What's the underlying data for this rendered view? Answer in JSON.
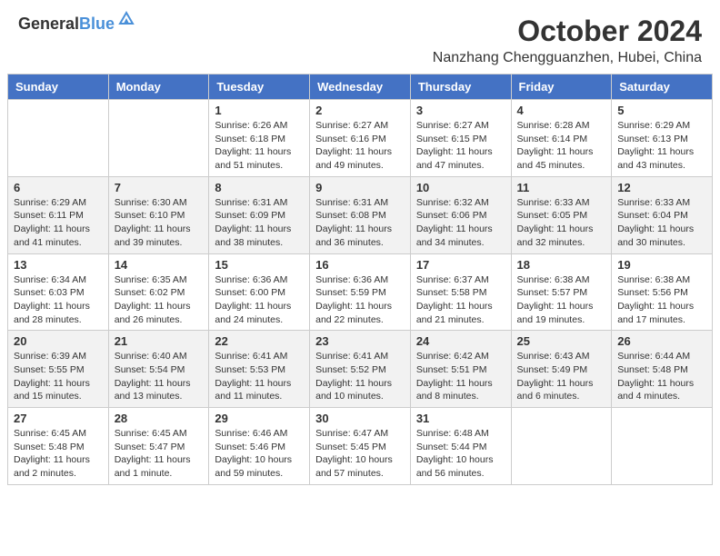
{
  "header": {
    "logo_general": "General",
    "logo_blue": "Blue",
    "month": "October 2024",
    "location": "Nanzhang Chengguanzhen, Hubei, China"
  },
  "days_of_week": [
    "Sunday",
    "Monday",
    "Tuesday",
    "Wednesday",
    "Thursday",
    "Friday",
    "Saturday"
  ],
  "weeks": [
    [
      {
        "day": "",
        "sunrise": "",
        "sunset": "",
        "daylight": ""
      },
      {
        "day": "",
        "sunrise": "",
        "sunset": "",
        "daylight": ""
      },
      {
        "day": "1",
        "sunrise": "Sunrise: 6:26 AM",
        "sunset": "Sunset: 6:18 PM",
        "daylight": "Daylight: 11 hours and 51 minutes."
      },
      {
        "day": "2",
        "sunrise": "Sunrise: 6:27 AM",
        "sunset": "Sunset: 6:16 PM",
        "daylight": "Daylight: 11 hours and 49 minutes."
      },
      {
        "day": "3",
        "sunrise": "Sunrise: 6:27 AM",
        "sunset": "Sunset: 6:15 PM",
        "daylight": "Daylight: 11 hours and 47 minutes."
      },
      {
        "day": "4",
        "sunrise": "Sunrise: 6:28 AM",
        "sunset": "Sunset: 6:14 PM",
        "daylight": "Daylight: 11 hours and 45 minutes."
      },
      {
        "day": "5",
        "sunrise": "Sunrise: 6:29 AM",
        "sunset": "Sunset: 6:13 PM",
        "daylight": "Daylight: 11 hours and 43 minutes."
      }
    ],
    [
      {
        "day": "6",
        "sunrise": "Sunrise: 6:29 AM",
        "sunset": "Sunset: 6:11 PM",
        "daylight": "Daylight: 11 hours and 41 minutes."
      },
      {
        "day": "7",
        "sunrise": "Sunrise: 6:30 AM",
        "sunset": "Sunset: 6:10 PM",
        "daylight": "Daylight: 11 hours and 39 minutes."
      },
      {
        "day": "8",
        "sunrise": "Sunrise: 6:31 AM",
        "sunset": "Sunset: 6:09 PM",
        "daylight": "Daylight: 11 hours and 38 minutes."
      },
      {
        "day": "9",
        "sunrise": "Sunrise: 6:31 AM",
        "sunset": "Sunset: 6:08 PM",
        "daylight": "Daylight: 11 hours and 36 minutes."
      },
      {
        "day": "10",
        "sunrise": "Sunrise: 6:32 AM",
        "sunset": "Sunset: 6:06 PM",
        "daylight": "Daylight: 11 hours and 34 minutes."
      },
      {
        "day": "11",
        "sunrise": "Sunrise: 6:33 AM",
        "sunset": "Sunset: 6:05 PM",
        "daylight": "Daylight: 11 hours and 32 minutes."
      },
      {
        "day": "12",
        "sunrise": "Sunrise: 6:33 AM",
        "sunset": "Sunset: 6:04 PM",
        "daylight": "Daylight: 11 hours and 30 minutes."
      }
    ],
    [
      {
        "day": "13",
        "sunrise": "Sunrise: 6:34 AM",
        "sunset": "Sunset: 6:03 PM",
        "daylight": "Daylight: 11 hours and 28 minutes."
      },
      {
        "day": "14",
        "sunrise": "Sunrise: 6:35 AM",
        "sunset": "Sunset: 6:02 PM",
        "daylight": "Daylight: 11 hours and 26 minutes."
      },
      {
        "day": "15",
        "sunrise": "Sunrise: 6:36 AM",
        "sunset": "Sunset: 6:00 PM",
        "daylight": "Daylight: 11 hours and 24 minutes."
      },
      {
        "day": "16",
        "sunrise": "Sunrise: 6:36 AM",
        "sunset": "Sunset: 5:59 PM",
        "daylight": "Daylight: 11 hours and 22 minutes."
      },
      {
        "day": "17",
        "sunrise": "Sunrise: 6:37 AM",
        "sunset": "Sunset: 5:58 PM",
        "daylight": "Daylight: 11 hours and 21 minutes."
      },
      {
        "day": "18",
        "sunrise": "Sunrise: 6:38 AM",
        "sunset": "Sunset: 5:57 PM",
        "daylight": "Daylight: 11 hours and 19 minutes."
      },
      {
        "day": "19",
        "sunrise": "Sunrise: 6:38 AM",
        "sunset": "Sunset: 5:56 PM",
        "daylight": "Daylight: 11 hours and 17 minutes."
      }
    ],
    [
      {
        "day": "20",
        "sunrise": "Sunrise: 6:39 AM",
        "sunset": "Sunset: 5:55 PM",
        "daylight": "Daylight: 11 hours and 15 minutes."
      },
      {
        "day": "21",
        "sunrise": "Sunrise: 6:40 AM",
        "sunset": "Sunset: 5:54 PM",
        "daylight": "Daylight: 11 hours and 13 minutes."
      },
      {
        "day": "22",
        "sunrise": "Sunrise: 6:41 AM",
        "sunset": "Sunset: 5:53 PM",
        "daylight": "Daylight: 11 hours and 11 minutes."
      },
      {
        "day": "23",
        "sunrise": "Sunrise: 6:41 AM",
        "sunset": "Sunset: 5:52 PM",
        "daylight": "Daylight: 11 hours and 10 minutes."
      },
      {
        "day": "24",
        "sunrise": "Sunrise: 6:42 AM",
        "sunset": "Sunset: 5:51 PM",
        "daylight": "Daylight: 11 hours and 8 minutes."
      },
      {
        "day": "25",
        "sunrise": "Sunrise: 6:43 AM",
        "sunset": "Sunset: 5:49 PM",
        "daylight": "Daylight: 11 hours and 6 minutes."
      },
      {
        "day": "26",
        "sunrise": "Sunrise: 6:44 AM",
        "sunset": "Sunset: 5:48 PM",
        "daylight": "Daylight: 11 hours and 4 minutes."
      }
    ],
    [
      {
        "day": "27",
        "sunrise": "Sunrise: 6:45 AM",
        "sunset": "Sunset: 5:48 PM",
        "daylight": "Daylight: 11 hours and 2 minutes."
      },
      {
        "day": "28",
        "sunrise": "Sunrise: 6:45 AM",
        "sunset": "Sunset: 5:47 PM",
        "daylight": "Daylight: 11 hours and 1 minute."
      },
      {
        "day": "29",
        "sunrise": "Sunrise: 6:46 AM",
        "sunset": "Sunset: 5:46 PM",
        "daylight": "Daylight: 10 hours and 59 minutes."
      },
      {
        "day": "30",
        "sunrise": "Sunrise: 6:47 AM",
        "sunset": "Sunset: 5:45 PM",
        "daylight": "Daylight: 10 hours and 57 minutes."
      },
      {
        "day": "31",
        "sunrise": "Sunrise: 6:48 AM",
        "sunset": "Sunset: 5:44 PM",
        "daylight": "Daylight: 10 hours and 56 minutes."
      },
      {
        "day": "",
        "sunrise": "",
        "sunset": "",
        "daylight": ""
      },
      {
        "day": "",
        "sunrise": "",
        "sunset": "",
        "daylight": ""
      }
    ]
  ]
}
